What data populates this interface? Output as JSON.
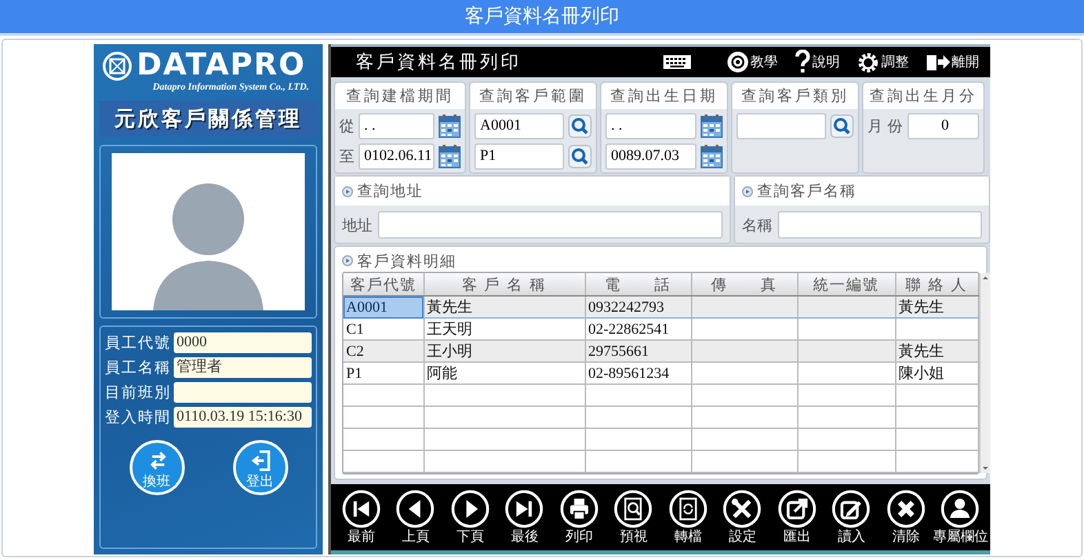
{
  "title_bar": {
    "title": "客戶資料名冊列印"
  },
  "sidebar": {
    "logo": "DATAPRO",
    "logo_subtitle": "Datapro Information System Co., LTD.",
    "app_name": "元欣客戶關係管理",
    "fields": [
      {
        "label": "員工代號",
        "value": "0000"
      },
      {
        "label": "員工名稱",
        "value": "管理者"
      },
      {
        "label": "目前班別"
      },
      {
        "label": "登入時間",
        "value": "0110.03.19 15:16:30"
      }
    ],
    "buttons": [
      {
        "kind": "switch",
        "label": "換班"
      },
      {
        "kind": "logout",
        "label": "登出"
      }
    ]
  },
  "header": {
    "title": "客戶資料名冊列印",
    "tools": [
      {
        "kind": "keyboard"
      },
      {
        "kind": "disc",
        "label": "教學"
      },
      {
        "kind": "help",
        "label": "說明"
      },
      {
        "kind": "settings",
        "label": "調整"
      },
      {
        "kind": "exit",
        "label": "離開"
      }
    ]
  },
  "filters": [
    {
      "title": "查詢建檔期間",
      "rows": [
        {
          "kind": "date",
          "prefix": "從",
          "value": ". ."
        },
        {
          "kind": "date",
          "prefix": "至",
          "value": "0102.06.11"
        }
      ]
    },
    {
      "title": "查詢客戶範圍",
      "rows": [
        {
          "kind": "lookup",
          "value": "A0001"
        },
        {
          "kind": "lookup",
          "value": "P1"
        }
      ]
    },
    {
      "title": "查詢出生日期",
      "rows": [
        {
          "kind": "date",
          "value": ". ."
        },
        {
          "kind": "date",
          "value": "0089.07.03"
        }
      ]
    },
    {
      "title": "查詢客戶類別",
      "rows": [
        {
          "kind": "lookup"
        }
      ]
    },
    {
      "title": "查詢出生月分",
      "rows": [
        {
          "kind": "number",
          "prefix": "月 份",
          "value": "0"
        }
      ]
    }
  ],
  "address": {
    "title": "查詢地址",
    "label": "地址"
  },
  "customer_name": {
    "title": "查詢客戶名稱",
    "label": "名稱"
  },
  "table": {
    "title": "客戶資料明細",
    "columns": [
      "客戶代號",
      "客 戶 名 稱",
      "電　　話",
      "傳　　真",
      "統一編號",
      "聯 絡 人"
    ],
    "rows": [
      {
        "selected": true,
        "cells": [
          "A0001",
          "黃先生",
          "0932242793",
          "",
          "",
          "黃先生"
        ]
      },
      {
        "selected": false,
        "cells": [
          "C1",
          "王天明",
          "02-22862541",
          "",
          "",
          ""
        ]
      },
      {
        "selected": false,
        "cells": [
          "C2",
          "王小明",
          "29755661",
          "",
          "",
          "黃先生"
        ]
      },
      {
        "selected": false,
        "cells": [
          "P1",
          "阿能",
          "02-89561234",
          "",
          "",
          "陳小姐"
        ]
      }
    ]
  },
  "toolbar": [
    {
      "kind": "first",
      "label": "最前"
    },
    {
      "kind": "prev",
      "label": "上頁"
    },
    {
      "kind": "next",
      "label": "下頁"
    },
    {
      "kind": "last",
      "label": "最後"
    },
    {
      "kind": "print",
      "label": "列印"
    },
    {
      "kind": "preview",
      "label": "預視"
    },
    {
      "kind": "convert",
      "label": "轉檔"
    },
    {
      "kind": "setup",
      "label": "設定"
    },
    {
      "kind": "export",
      "label": "匯出"
    },
    {
      "kind": "import",
      "label": "讀入"
    },
    {
      "kind": "clear",
      "label": "清除"
    },
    {
      "kind": "custom",
      "label": "專屬欄位"
    }
  ]
}
